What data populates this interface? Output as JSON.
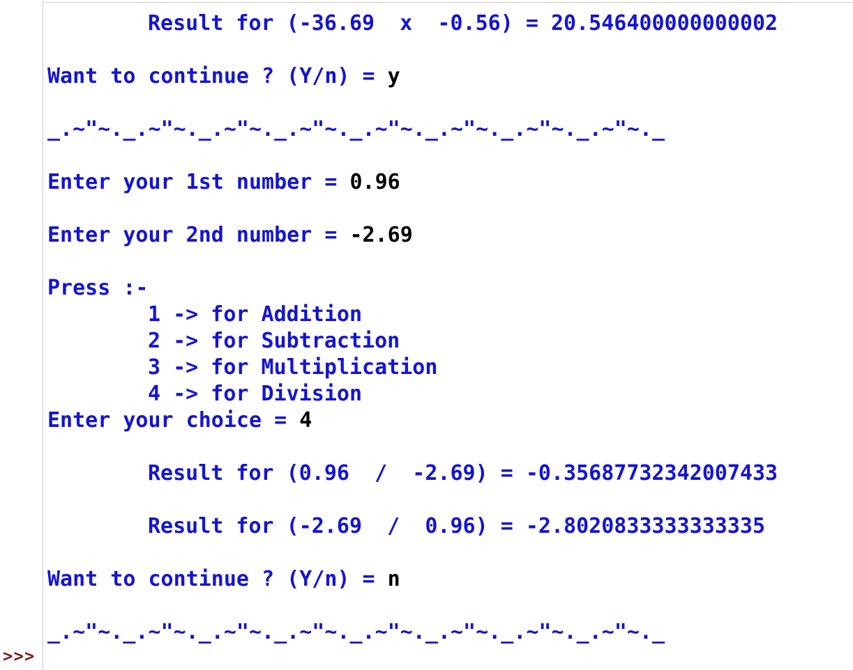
{
  "colors": {
    "output_text": "#1414d2",
    "user_input": "#000000",
    "prompt": "#7a1e1e",
    "background": "#ffffff"
  },
  "shell": {
    "prompt": ">>>"
  },
  "session": {
    "result_mul": "Result for (-36.69  x  -0.56) = 20.546400000000002",
    "continue_prompt_1": "Want to continue ? (Y/n) = ",
    "continue_answer_1": "y",
    "separator_1": "_.~\"~._.~\"~._.~\"~._.~\"~._.~\"~._.~\"~._.~\"~._.~\"~._",
    "first_number_prompt": "Enter your 1st number = ",
    "first_number_value": "0.96",
    "second_number_prompt": "Enter your 2nd number = ",
    "second_number_value": "-2.69",
    "menu_title": "Press :-",
    "menu_options": [
      "1 -> for Addition",
      "2 -> for Subtraction",
      "3 -> for Multiplication",
      "4 -> for Division"
    ],
    "choice_prompt": "Enter your choice = ",
    "choice_value": "4",
    "result_div_1": "Result for (0.96  /  -2.69) = -0.35687732342007433",
    "result_div_2": "Result for (-2.69  /  0.96) = -2.8020833333333335",
    "continue_prompt_2": "Want to continue ? (Y/n) = ",
    "continue_answer_2": "n",
    "separator_2": "_.~\"~._.~\"~._.~\"~._.~\"~._.~\"~._.~\"~._.~\"~._.~\"~._"
  }
}
